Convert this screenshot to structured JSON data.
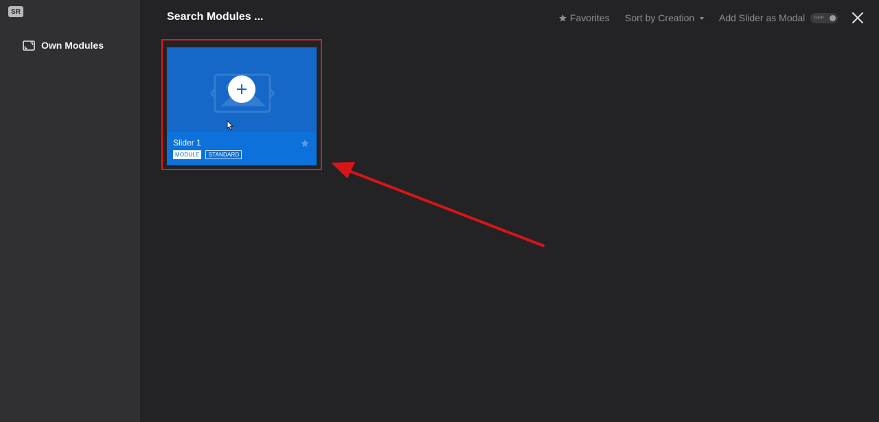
{
  "sidebar": {
    "logo": "SR",
    "nav": [
      {
        "label": "Own Modules",
        "icon": "image-frame-icon"
      }
    ]
  },
  "header": {
    "search_placeholder": "Search Modules ...",
    "favorites_label": "Favorites",
    "sort_label": "Sort by Creation",
    "modal_label": "Add Slider as Modal",
    "modal_toggle": "OFF"
  },
  "modules": [
    {
      "title": "Slider 1",
      "tags": [
        "MODULE",
        "STANDARD"
      ],
      "favorite": false
    }
  ],
  "colors": {
    "highlight": "#e0191c",
    "card_blue": "#0c71da",
    "annotation_arrow": "#d71518"
  }
}
